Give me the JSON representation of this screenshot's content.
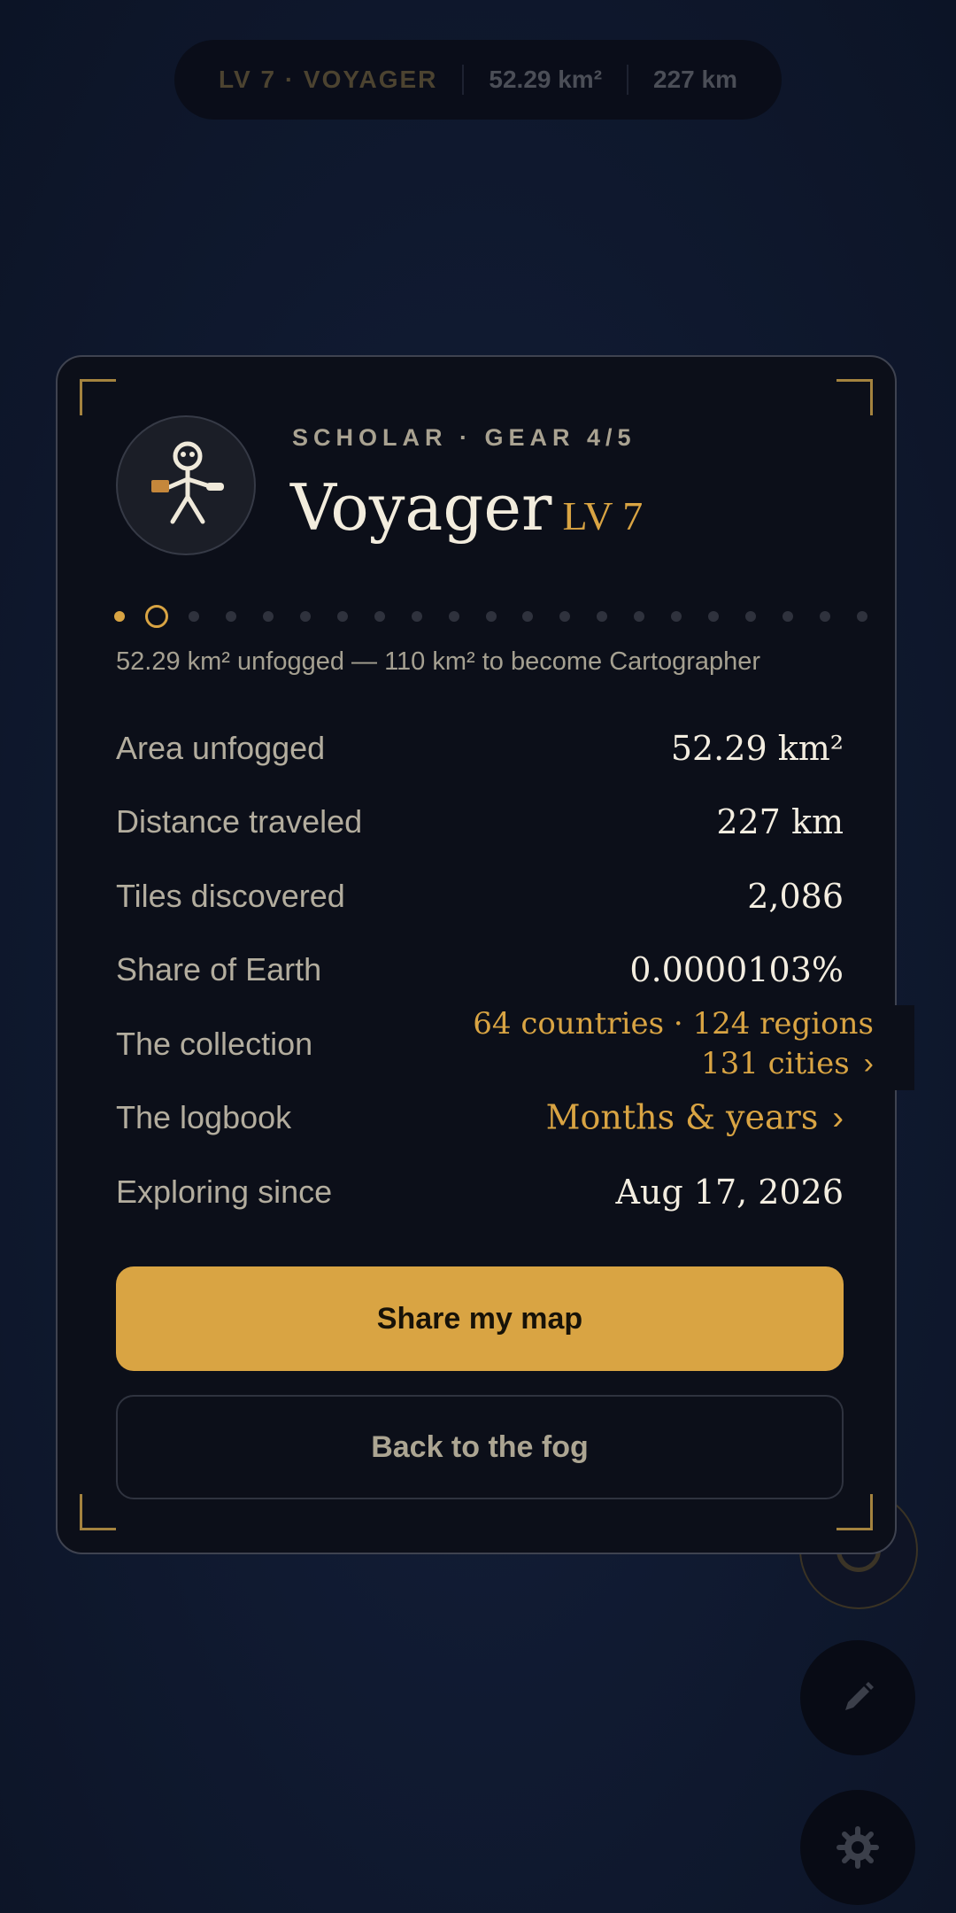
{
  "top_stats": {
    "level": "LV 7 · VOYAGER",
    "area": "52.29 km²",
    "distance": "227 km"
  },
  "card": {
    "kicker": "SCHOLAR · GEAR 4/5",
    "rank_name": "Voyager",
    "level": "LV 7",
    "progress": {
      "completed": 1,
      "current": 2,
      "total": 21
    },
    "progress_text": "52.29 km² unfogged — 110 km² to become Cartographer",
    "stats": {
      "area_label": "Area unfogged",
      "area_value": "52.29 km²",
      "distance_label": "Distance traveled",
      "distance_value": "227 km",
      "tiles_label": "Tiles discovered",
      "tiles_value": "2,086",
      "share_label": "Share of Earth",
      "share_value": "0.0000103%",
      "collection_label": "The collection",
      "collection_line1": "64 countries · 124 regions",
      "collection_line2": "131 cities",
      "logbook_label": "The logbook",
      "logbook_value": "Months & years",
      "since_label": "Exploring since",
      "since_value": "Aug 17, 2026"
    },
    "chevron": "›",
    "share_button": "Share my map",
    "back_button": "Back to the fog"
  },
  "icons": {
    "avatar": "voyager-figure-icon",
    "locate": "locate-icon",
    "edit": "pencil-icon",
    "settings": "gear-icon"
  },
  "colors": {
    "accent": "#d9a443",
    "background": "#101a31",
    "card": "#0c0f19"
  }
}
